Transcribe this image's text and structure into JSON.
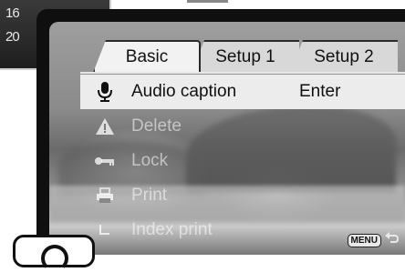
{
  "background_panel": {
    "numbers": [
      "16",
      "20"
    ]
  },
  "tabs": [
    {
      "label": "Basic",
      "active": true
    },
    {
      "label": "Setup 1",
      "active": false
    },
    {
      "label": "Setup 2",
      "active": false
    }
  ],
  "menu": {
    "items": [
      {
        "icon": "microphone-icon",
        "label": "Audio caption",
        "value": "Enter",
        "selected": true,
        "enabled": true
      },
      {
        "icon": "warning-triangle-icon",
        "label": "Delete",
        "value": "",
        "selected": false,
        "enabled": false
      },
      {
        "icon": "key-icon",
        "label": "Lock",
        "value": "",
        "selected": false,
        "enabled": false
      },
      {
        "icon": "printer-icon",
        "label": "Print",
        "value": "",
        "selected": false,
        "enabled": false
      },
      {
        "icon": "sub-item-corner-icon",
        "label": "Index print",
        "value": "",
        "selected": false,
        "enabled": false
      }
    ]
  },
  "footer": {
    "menu_key_label": "MENU",
    "back_icon": "return-arrow-icon"
  },
  "colors": {
    "selected_row": "#ececec",
    "active_tab": "#f2f2f2",
    "inactive_tab": "#d8d8d8",
    "screen_frame": "#0f0f0f"
  }
}
